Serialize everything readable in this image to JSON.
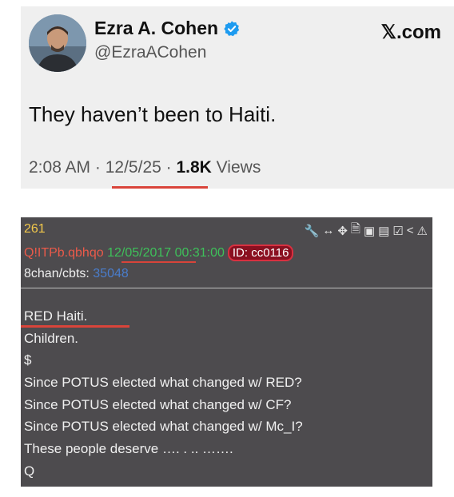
{
  "tweet": {
    "display_name": "Ezra A. Cohen",
    "handle": "@EzraACohen",
    "site": "𝕏.com",
    "text": "They haven’t been to Haiti.",
    "time": "2:08 AM",
    "sep1": " · ",
    "date": "12/5/25",
    "sep2": " · ",
    "views_count": "1.8K",
    "views_label": " Views",
    "verified_color": "#1d9bf0"
  },
  "post": {
    "number": "261",
    "tripcode": "Q!ITPb.qbhqo",
    "datetime": "12/05/2017 00:31:00",
    "id_label": "ID: cc0116",
    "board_label": "8chan/cbts: ",
    "board_number": "35048",
    "toolbar_icons": [
      "wrench-icon",
      "arrows-h-icon",
      "move-icon",
      "document-icon",
      "glasses-icon",
      "clipboard-icon",
      "clipboard-check-icon",
      "share-icon",
      "warning-icon"
    ],
    "body": [
      "RED Haiti.",
      "Children.",
      "$",
      "Since POTUS elected what changed w/ RED?",
      "Since POTUS elected what changed w/ CF?",
      "Since POTUS elected what changed w/ Mc_I?",
      "These people deserve …. . .. …….",
      "Q"
    ]
  },
  "colors": {
    "underline": "#d9443a",
    "post_bg": "#4d4b4e",
    "number_yellow": "#f2c84b",
    "name_red": "#ea5a4a",
    "date_green": "#3ec05a",
    "link_blue": "#4a7dcc"
  }
}
